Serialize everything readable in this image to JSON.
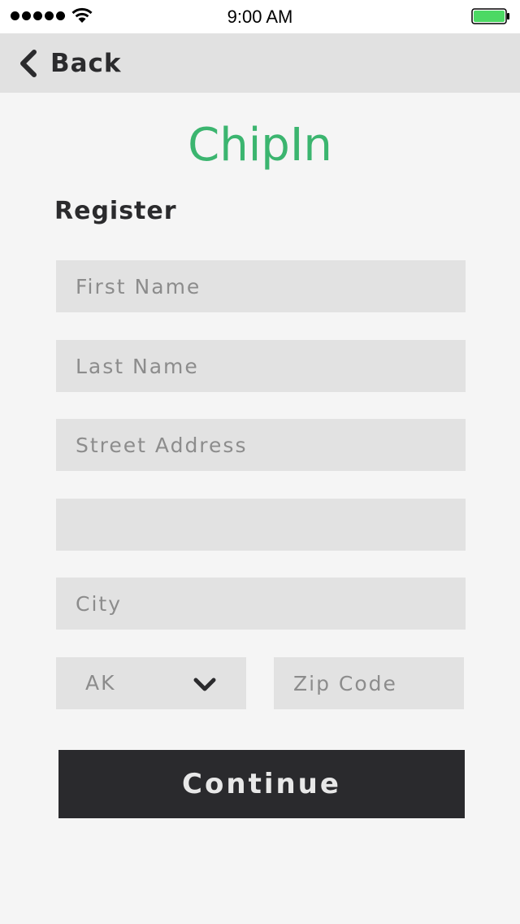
{
  "status_bar": {
    "time": "9:00 AM",
    "signal_dots": 5,
    "battery_level": 1.0,
    "battery_color": "#4cd964"
  },
  "nav": {
    "back_label": "Back",
    "back_icon": "chevron-left-icon"
  },
  "app": {
    "brand_name": "ChipIn",
    "brand_color": "#3bb56f"
  },
  "form": {
    "heading": "Register",
    "first_name": {
      "placeholder": "First Name",
      "value": ""
    },
    "last_name": {
      "placeholder": "Last Name",
      "value": ""
    },
    "street_address": {
      "placeholder": "Street Address",
      "value": ""
    },
    "street_address_2": {
      "placeholder": "",
      "value": ""
    },
    "city": {
      "placeholder": "City",
      "value": ""
    },
    "state": {
      "selected": "AK",
      "icon": "chevron-down-icon"
    },
    "zip_code": {
      "placeholder": "Zip Code",
      "value": ""
    },
    "continue_label": "Continue"
  },
  "colors": {
    "nav_background": "#e1e1e1",
    "field_background": "#e2e2e2",
    "button_background": "#2a2a2d",
    "page_background": "#f5f5f5"
  }
}
